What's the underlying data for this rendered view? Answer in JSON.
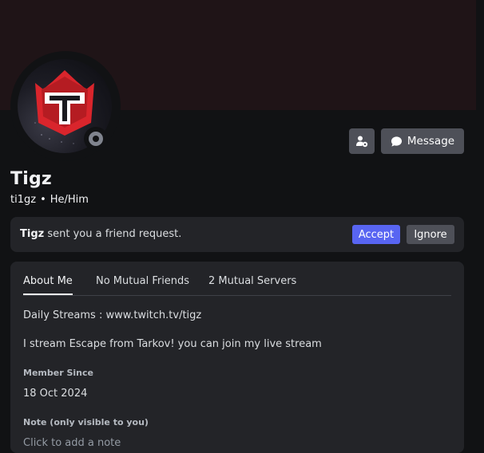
{
  "profile": {
    "display_name": "Tigz",
    "username": "ti1gz",
    "separator": "•",
    "pronouns": "He/Him",
    "status": "offline",
    "avatar_letter": "T"
  },
  "actions": {
    "add_friend_icon": "user-settings-icon",
    "message_icon": "chat-bubble-icon",
    "message_label": "Message"
  },
  "friend_request": {
    "name": "Tigz",
    "text": "sent you a friend request.",
    "accept_label": "Accept",
    "ignore_label": "Ignore"
  },
  "tabs": [
    {
      "label": "About Me",
      "active": true
    },
    {
      "label": "No Mutual Friends",
      "active": false
    },
    {
      "label": "2 Mutual Servers",
      "active": false
    }
  ],
  "about": {
    "line1": "Daily Streams : www.twitch.tv/tigz",
    "line2": "I stream Escape from Tarkov! you can join my live stream",
    "member_since_label": "Member Since",
    "member_since_value": "18 Oct 2024",
    "note_label": "Note (only visible to you)",
    "note_placeholder": "Click to add a note"
  },
  "colors": {
    "banner": "#1f1417",
    "background": "#111214",
    "card": "#232428",
    "accept": "#5865f2",
    "secondary_button": "#4e5058",
    "status_offline": "#80848e",
    "logo_red": "#d9252c"
  }
}
